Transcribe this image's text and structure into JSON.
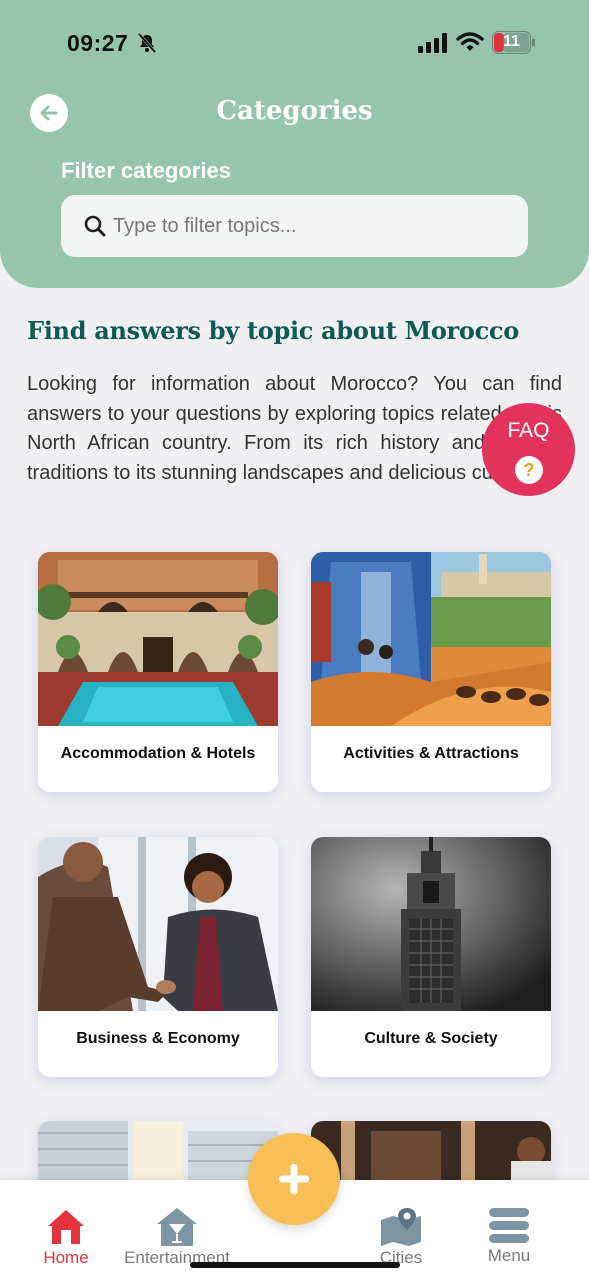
{
  "status_bar": {
    "time": "09:27",
    "battery": "11"
  },
  "header": {
    "title": "Categories",
    "filter_label": "Filter categories",
    "search_placeholder": "Type to filter topics..."
  },
  "intro": {
    "title": "Find answers by topic about Morocco",
    "text": "Looking for information about Morocco? You can find answers to your questions by exploring topics related to this North African country. From its rich history and cultural traditions to its stunning landscapes and delicious cuisine ..."
  },
  "faq": {
    "label": "FAQ",
    "icon": "?"
  },
  "categories": [
    {
      "label": "Accommodation & Hotels",
      "image": "riad-courtyard-pool"
    },
    {
      "label": "Activities & Attractions",
      "image": "medina-and-desert-camels"
    },
    {
      "label": "Business & Economy",
      "image": "business-handshake"
    },
    {
      "label": "Culture & Society",
      "image": "minaret-tower"
    },
    {
      "label": "",
      "image": "modern-buildings"
    },
    {
      "label": "",
      "image": "restaurant-interior"
    }
  ],
  "nav": {
    "items": [
      {
        "label": "Home",
        "icon": "home-icon",
        "active": true
      },
      {
        "label": "Entertainment",
        "icon": "cocktail-icon",
        "active": false
      },
      {
        "label": "Cities",
        "icon": "map-pin-icon",
        "active": false
      },
      {
        "label": "Menu",
        "icon": "menu-icon",
        "active": false
      }
    ],
    "fab_icon": "plus-icon"
  },
  "colors": {
    "header": "#96c4ad",
    "accent_title": "#0d5a50",
    "faq": "#e1335c",
    "fab": "#f7bf55",
    "active_nav": "#e0333c"
  }
}
